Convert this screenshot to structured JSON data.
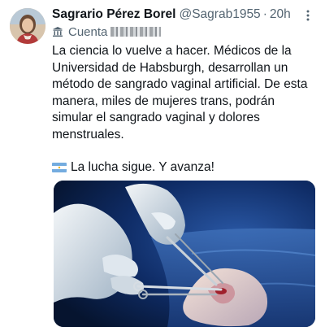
{
  "tweet": {
    "author_name": "Sagrario Pérez Borel",
    "author_handle": "@Sagrab1955",
    "separator": "·",
    "time": "20h",
    "account_label": "Cuenta",
    "text": "La ciencia lo vuelve a hacer. Médicos de la Universidad de Habsburgh, desarrollan un método de sangrado vaginal artificial. De esta manera, miles de mujeres trans, podrán simular el sangrado vaginal y dolores menstruales.",
    "text2": "La lucha sigue. Y avanza!",
    "more_icon": "more-vertical-icon",
    "flag_icon": "argentina-flag-icon",
    "media_icon": "surgery-image"
  },
  "colors": {
    "primary_text": "#0f1419",
    "secondary_text": "#536471",
    "media_background": "#0b1d3f"
  }
}
